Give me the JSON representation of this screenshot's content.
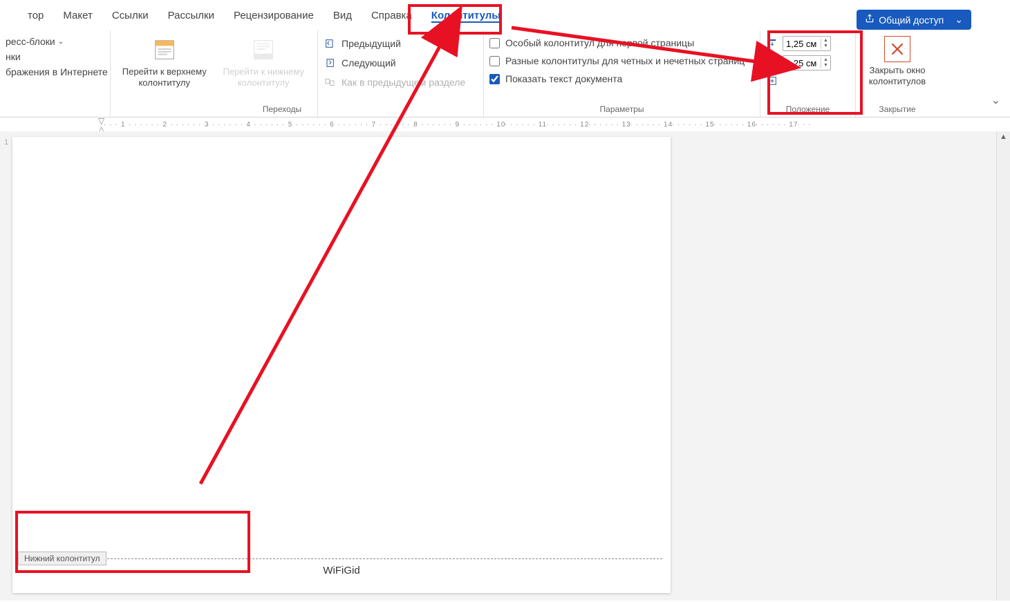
{
  "tabs": {
    "partial_first": "тор",
    "layout": "Макет",
    "links": "Ссылки",
    "mailings": "Рассылки",
    "review": "Рецензирование",
    "view": "Вид",
    "help": "Справка",
    "header_footer": "Колонтитулы"
  },
  "share_label": "Общий доступ",
  "ribbon": {
    "group_left": {
      "express_blocks": "ресс-блоки",
      "pictures": "нки",
      "online_pictures": "бражения в Интернете"
    },
    "nav": {
      "goto_header": "Перейти к верхнему колонтитулу",
      "goto_footer": "Перейти к нижнему колонтитулу",
      "group_label": "Переходы"
    },
    "transitions": {
      "previous": "Предыдущий",
      "next": "Следующий",
      "same_as_prev": "Как в предыдущем разделе"
    },
    "params": {
      "first_page_diff": "Особый колонтитул для первой страницы",
      "odd_even_diff": "Разные колонтитулы для четных и нечетных страниц",
      "show_doc_text": "Показать текст документа",
      "group_label": "Параметры"
    },
    "position": {
      "header_val": "1,25 см",
      "footer_val": "1,25 см",
      "group_label": "Положение"
    },
    "close": {
      "label": "Закрыть окно колонтитулов",
      "group_label": "Закрытие"
    }
  },
  "ruler_page_number": "1",
  "footer": {
    "tag": "Нижний колонтитул",
    "text": "WiFiGid"
  }
}
